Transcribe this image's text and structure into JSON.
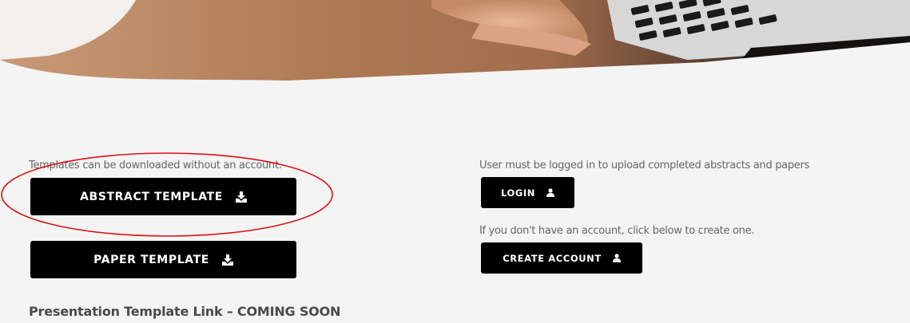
{
  "left": {
    "note": "Templates can be downloaded without an account.",
    "abstract_button": "ABSTRACT TEMPLATE",
    "paper_button": "PAPER TEMPLATE",
    "coming_soon_heading": "Presentation Template Link – COMING SOON"
  },
  "right": {
    "login_note": "User must be logged in to upload completed abstracts and papers",
    "login_button": "LOGIN",
    "create_note": "If you don't have an account, click below to create one.",
    "create_button": "CREATE ACCOUNT"
  },
  "icons": {
    "download": "download-icon",
    "user": "user-icon"
  },
  "colors": {
    "background": "#f4f4f4",
    "button_bg": "#000000",
    "button_text": "#ffffff",
    "note_text": "#666666",
    "annotation_circle": "#dd1111"
  }
}
